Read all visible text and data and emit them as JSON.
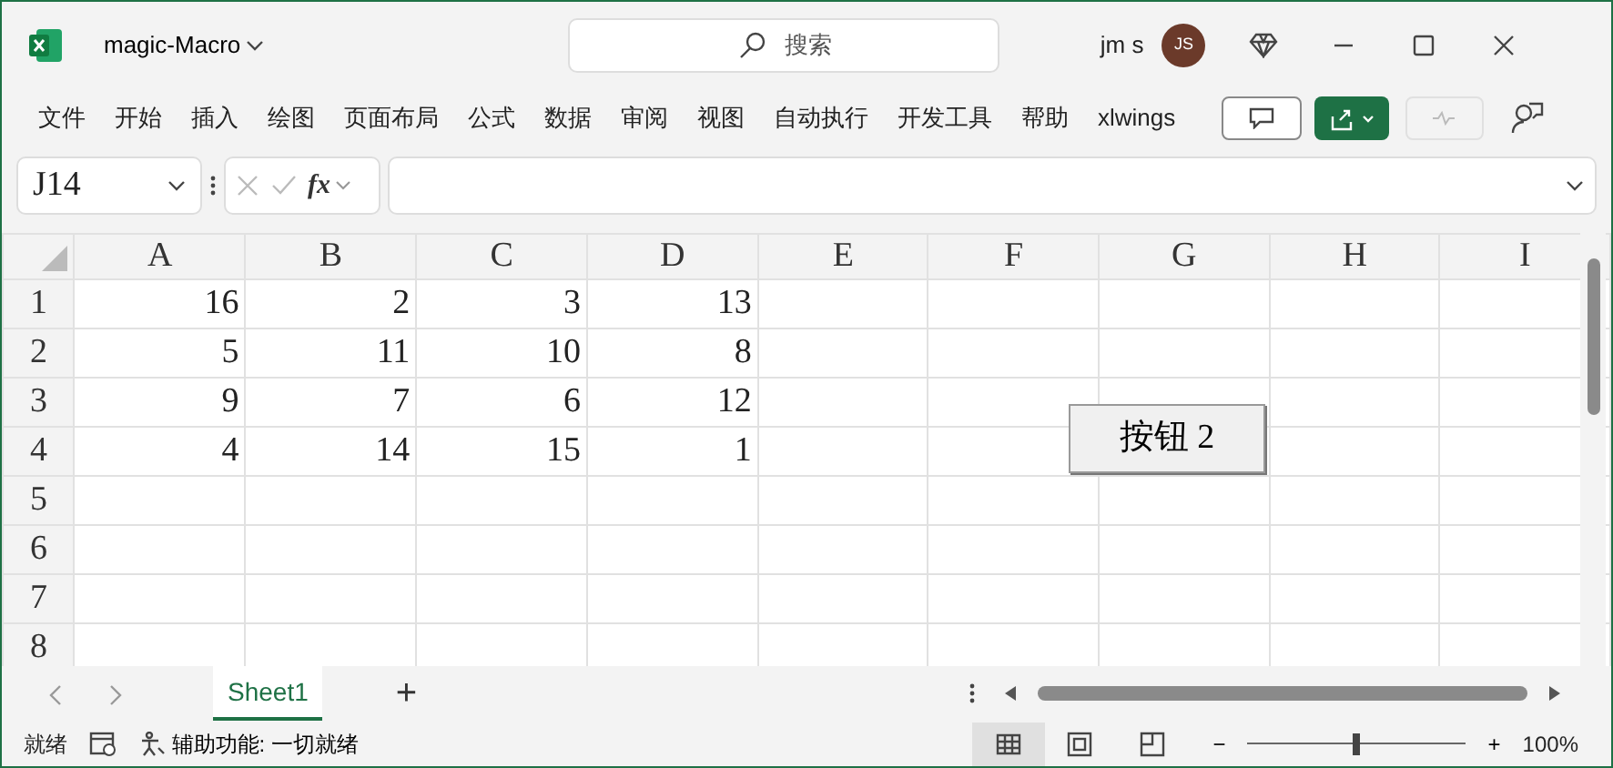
{
  "window": {
    "title": "magic-Macro",
    "search_placeholder": "搜索",
    "user": "jm s",
    "avatar": "JS"
  },
  "ribbon_tabs": [
    "文件",
    "开始",
    "插入",
    "绘图",
    "页面布局",
    "公式",
    "数据",
    "审阅",
    "视图",
    "自动执行",
    "开发工具",
    "帮助",
    "xlwings"
  ],
  "formula_bar": {
    "name_box": "J14",
    "fx": "fx"
  },
  "sheet": {
    "columns": [
      "A",
      "B",
      "C",
      "D",
      "E",
      "F",
      "G",
      "H",
      "I"
    ],
    "rows": [
      {
        "header": "1",
        "cells": [
          "16",
          "2",
          "3",
          "13"
        ]
      },
      {
        "header": "2",
        "cells": [
          "5",
          "11",
          "10",
          "8"
        ]
      },
      {
        "header": "3",
        "cells": [
          "9",
          "7",
          "6",
          "12"
        ]
      },
      {
        "header": "4",
        "cells": [
          "4",
          "14",
          "15",
          "1"
        ]
      },
      {
        "header": "5",
        "cells": []
      },
      {
        "header": "6",
        "cells": []
      },
      {
        "header": "7",
        "cells": []
      },
      {
        "header": "8",
        "cells": []
      }
    ]
  },
  "form_button": "按钮 2",
  "sheet_tabs": [
    {
      "label": "Sheet1",
      "selected": true
    }
  ],
  "add_sheet": "+",
  "status_bar": {
    "ready": "就绪",
    "accessibility": "辅助功能: 一切就绪",
    "zoom_minus": "−",
    "zoom_plus": "+",
    "zoom_slider": {
      "level": 0.5
    },
    "zoom": "100%"
  }
}
